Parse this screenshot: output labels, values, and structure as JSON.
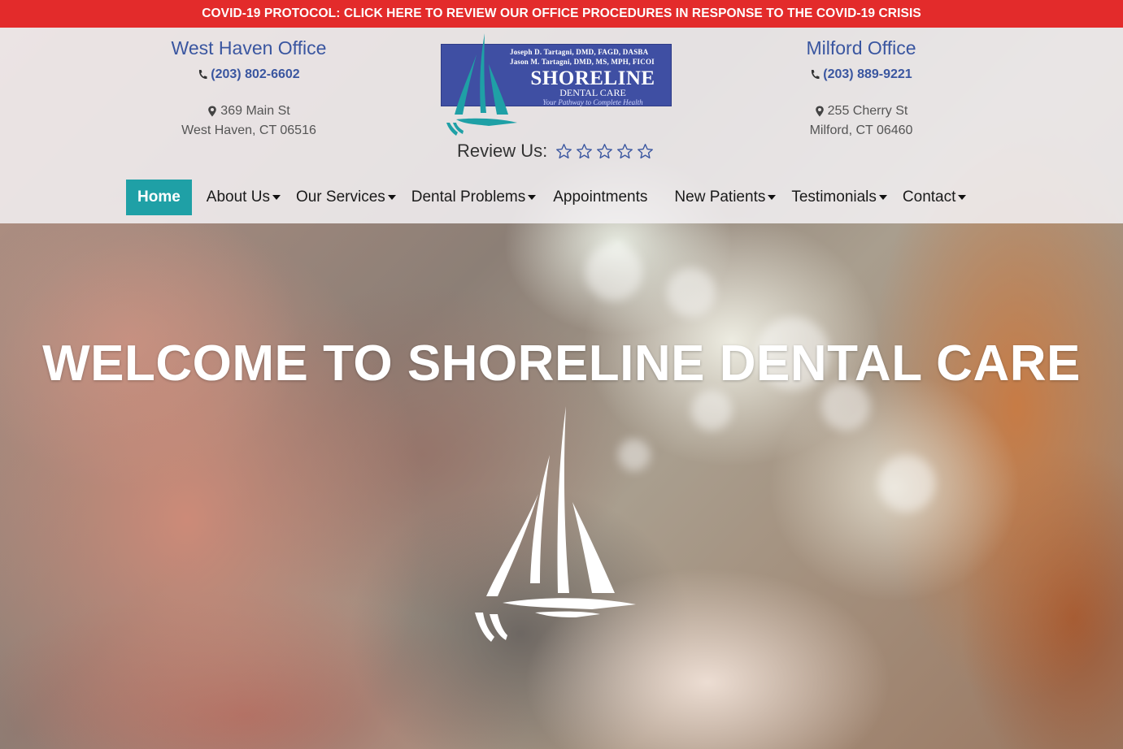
{
  "covid_banner": "COVID-19 PROTOCOL: CLICK HERE TO REVIEW OUR OFFICE PROCEDURES IN RESPONSE TO THE COVID-19 CRISIS",
  "offices": {
    "left": {
      "title": "West Haven Office",
      "phone": "(203) 802-6602",
      "street": "369 Main St",
      "city": "West Haven, CT 06516"
    },
    "right": {
      "title": "Milford Office",
      "phone": "(203) 889-9221",
      "street": "255 Cherry St",
      "city": "Milford, CT 06460"
    }
  },
  "logo": {
    "doctor1": "Joseph D. Tartagni, DMD, FAGD, DASBA",
    "doctor2": "Jason M. Tartagni, DMD, MS, MPH, FICOI",
    "brand": "SHORELINE",
    "sub": "DENTAL CARE",
    "tagline": "Your Pathway to Complete Health"
  },
  "review": {
    "label": "Review Us:",
    "stars": 5
  },
  "nav": {
    "items": [
      {
        "label": "Home"
      },
      {
        "label": "About Us"
      },
      {
        "label": "Our Services"
      },
      {
        "label": "Dental Problems"
      },
      {
        "label": "Appointments"
      },
      {
        "label": "New Patients"
      },
      {
        "label": "Testimonials"
      },
      {
        "label": "Contact"
      }
    ]
  },
  "hero": {
    "title": "WELCOME TO SHORELINE DENTAL CARE"
  },
  "colors": {
    "covid_red": "#e32b2b",
    "brand_blue": "#3a56a0",
    "logo_blue": "#3f4fa3",
    "nav_active": "#1fa0a6",
    "teal_sail": "#1fa0a6"
  }
}
